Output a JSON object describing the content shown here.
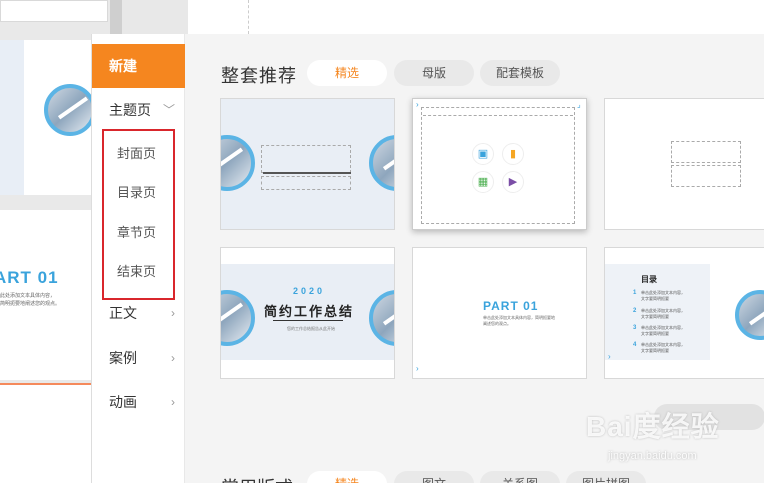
{
  "background": {
    "part_text": "ART 01",
    "tiny_text": "此处添加文本具体内容，\n简明扼要地阐述您的观点。"
  },
  "nav": {
    "new_label": "新建",
    "theme_label": "主题页",
    "sub_items": [
      "封面页",
      "目录页",
      "章节页",
      "结束页"
    ],
    "items": [
      "正文",
      "案例",
      "动画"
    ]
  },
  "section": {
    "title": "整套推荐",
    "tabs": [
      "精选",
      "母版",
      "配套模板"
    ]
  },
  "cards": {
    "year": "2020",
    "title": "简约工作总结",
    "subtitle": "您的工作总结报告从此开始",
    "part": "PART 01",
    "part_body": "单击此处添加文本具体内容，简明扼要地阐述您的观点。",
    "toc_title": "目录",
    "toc_items": [
      {
        "num": "1",
        "text": "单击此处添加文本内容，\n文字要简明扼要"
      },
      {
        "num": "2",
        "text": "单击此处添加文本内容，\n文字要简明扼要"
      },
      {
        "num": "3",
        "text": "单击此处添加文本内容，\n文字要简明扼要"
      },
      {
        "num": "4",
        "text": "单击此处添加文本内容，\n文字要简明扼要"
      }
    ]
  },
  "bottom": {
    "title": "常用版式",
    "tabs": [
      "精选",
      "图文",
      "关系图",
      "图片拼图"
    ]
  },
  "watermark": {
    "text": "Bai度经验",
    "url": "jingyan.baidu.com"
  },
  "colors": {
    "accent": "#f5861f",
    "highlight_box": "#d9262c",
    "slide_blue": "#3aa3dc"
  }
}
